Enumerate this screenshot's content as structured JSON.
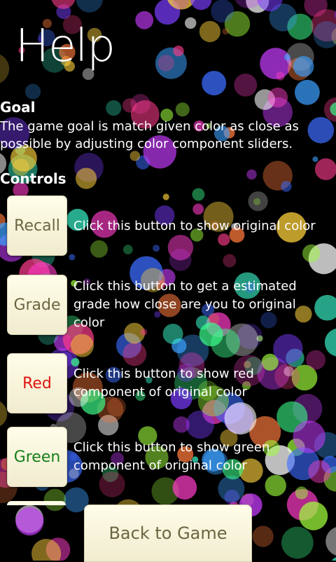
{
  "page": {
    "title": "Help"
  },
  "goal": {
    "heading": "Goal",
    "text": "The game goal is match given color as close as possible by adjusting color component sliders."
  },
  "controls": {
    "heading": "Controls",
    "items": [
      {
        "button_label": "Recall",
        "description": "Click this button to show original color"
      },
      {
        "button_label": "Grade",
        "description": "Click this button to get a estimated grade how close are you to original color"
      },
      {
        "button_label": "Red",
        "description": "Click this button to show red component of original color"
      },
      {
        "button_label": "Green",
        "description": "Click this button to show green component of original color"
      }
    ]
  },
  "footer": {
    "back_label": "Back to Game"
  },
  "colors": {
    "button_bg": "#fffde8",
    "button_text": "#6b6540",
    "red_text": "#e0140f",
    "green_text": "#157f1a",
    "background": "#000000"
  }
}
